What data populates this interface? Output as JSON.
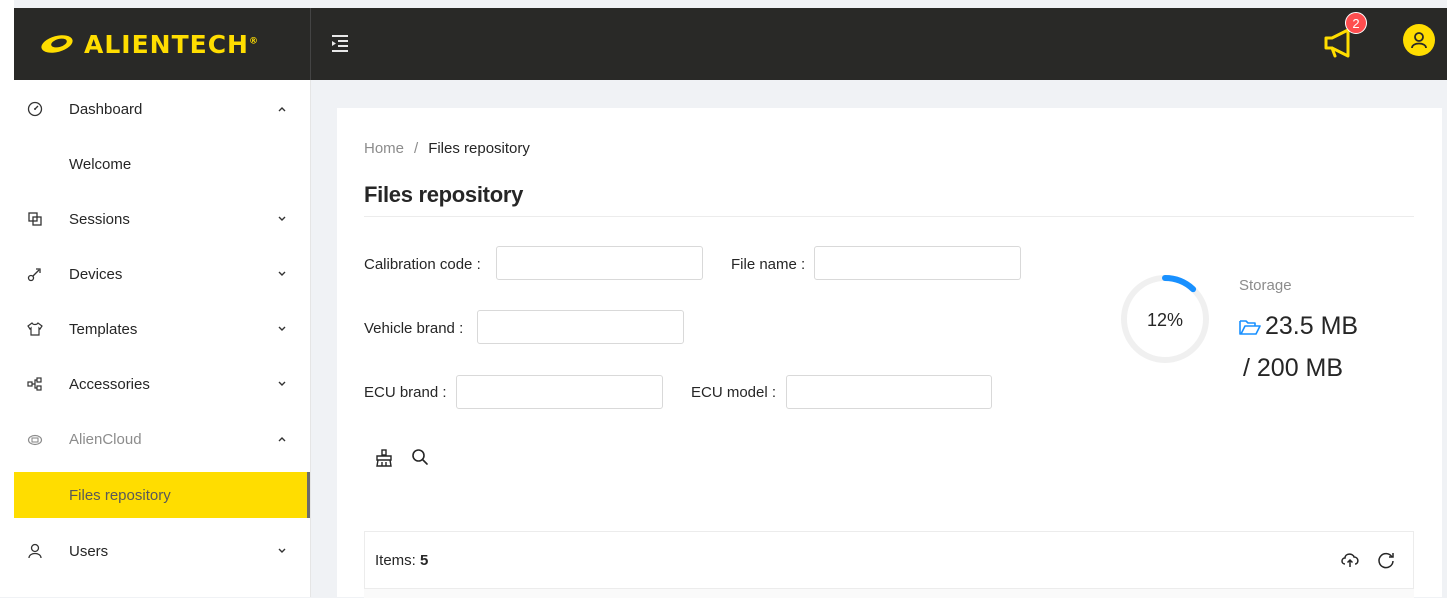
{
  "app": {
    "logo_text": "ALIENTECH",
    "logo_mark": "®",
    "notification_count": "2",
    "accent_color": "#ffdd00",
    "header_color": "#292927"
  },
  "sidebar": {
    "items": [
      {
        "label": "Dashboard",
        "icon": "dashboard-icon",
        "chevron": "up"
      },
      {
        "label": "Welcome",
        "sub": true
      },
      {
        "label": "Sessions",
        "icon": "sessions-icon",
        "chevron": "down"
      },
      {
        "label": "Devices",
        "icon": "devices-icon",
        "chevron": "down"
      },
      {
        "label": "Templates",
        "icon": "templates-icon",
        "chevron": "down"
      },
      {
        "label": "Accessories",
        "icon": "accessories-icon",
        "chevron": "down"
      },
      {
        "label": "AlienCloud",
        "icon": "cloud-icon",
        "chevron": "up",
        "muted": true
      },
      {
        "label": "Files repository",
        "sub": true,
        "active": true
      },
      {
        "label": "Users",
        "icon": "user-icon",
        "chevron": "down"
      }
    ]
  },
  "breadcrumb": {
    "home": "Home",
    "separator": "/",
    "current": "Files repository"
  },
  "page": {
    "title": "Files repository"
  },
  "filters": {
    "calibration_code": {
      "label": "Calibration code :",
      "value": ""
    },
    "file_name": {
      "label": "File name :",
      "value": ""
    },
    "vehicle_brand": {
      "label": "Vehicle brand :",
      "value": ""
    },
    "ecu_brand": {
      "label": "ECU brand :",
      "value": ""
    },
    "ecu_model": {
      "label": "ECU model :",
      "value": ""
    }
  },
  "storage": {
    "percent_label": "12%",
    "percent": 12,
    "label": "Storage",
    "used": "23.5 MB",
    "total": "/ 200 MB"
  },
  "table": {
    "items_label": "Items:",
    "items_count": "5"
  }
}
